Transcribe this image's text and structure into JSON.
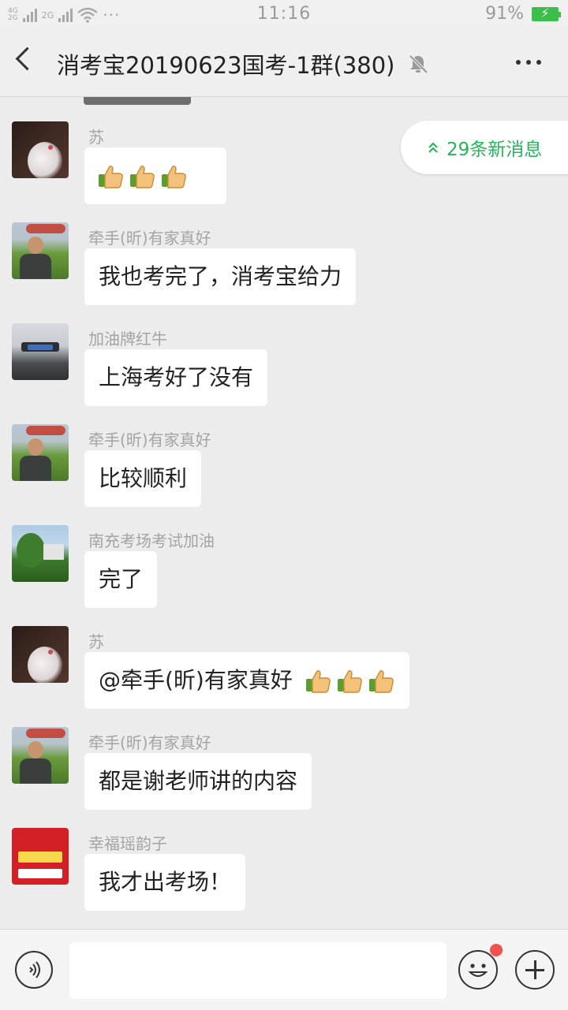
{
  "status_bar": {
    "network_top": "4G",
    "network_bottom": "2G",
    "network2": "2G",
    "time": "11:16",
    "battery_percent": "91%",
    "battery_level": 0.91,
    "ellipsis": "···"
  },
  "header": {
    "title": "消考宝20190623国考-1群(380)",
    "back_icon": "chevron-left-icon",
    "mute_icon": "bell-muted-icon",
    "more_icon": "more-dots-icon"
  },
  "new_messages": {
    "label": "29条新消息",
    "icon": "double-chevron-up-icon"
  },
  "messages": [
    {
      "sender": "苏",
      "text": "",
      "thumbs": 3
    },
    {
      "sender": "牵手(昕)有家真好",
      "text": "我也考完了，消考宝给力",
      "thumbs": 0
    },
    {
      "sender": "加油牌红牛",
      "text": "上海考好了没有",
      "thumbs": 0
    },
    {
      "sender": "牵手(昕)有家真好",
      "text": "比较顺利",
      "thumbs": 0
    },
    {
      "sender": "南充考场考试加油",
      "text": "完了",
      "thumbs": 0
    },
    {
      "sender": "苏",
      "text": "@牵手(昕)有家真好",
      "thumbs": 3
    },
    {
      "sender": "牵手(昕)有家真好",
      "text": "都是谢老师讲的内容",
      "thumbs": 0
    },
    {
      "sender": "幸福瑶韵子",
      "text": "我才出考场！",
      "thumbs": 0
    }
  ],
  "input_bar": {
    "voice_icon": "voice-icon",
    "emoji_icon": "emoji-icon",
    "plus_icon": "plus-icon",
    "input_value": ""
  },
  "colors": {
    "accent_green": "#27b45a",
    "badge_red": "#f2514c",
    "chat_bg": "#ececec"
  }
}
